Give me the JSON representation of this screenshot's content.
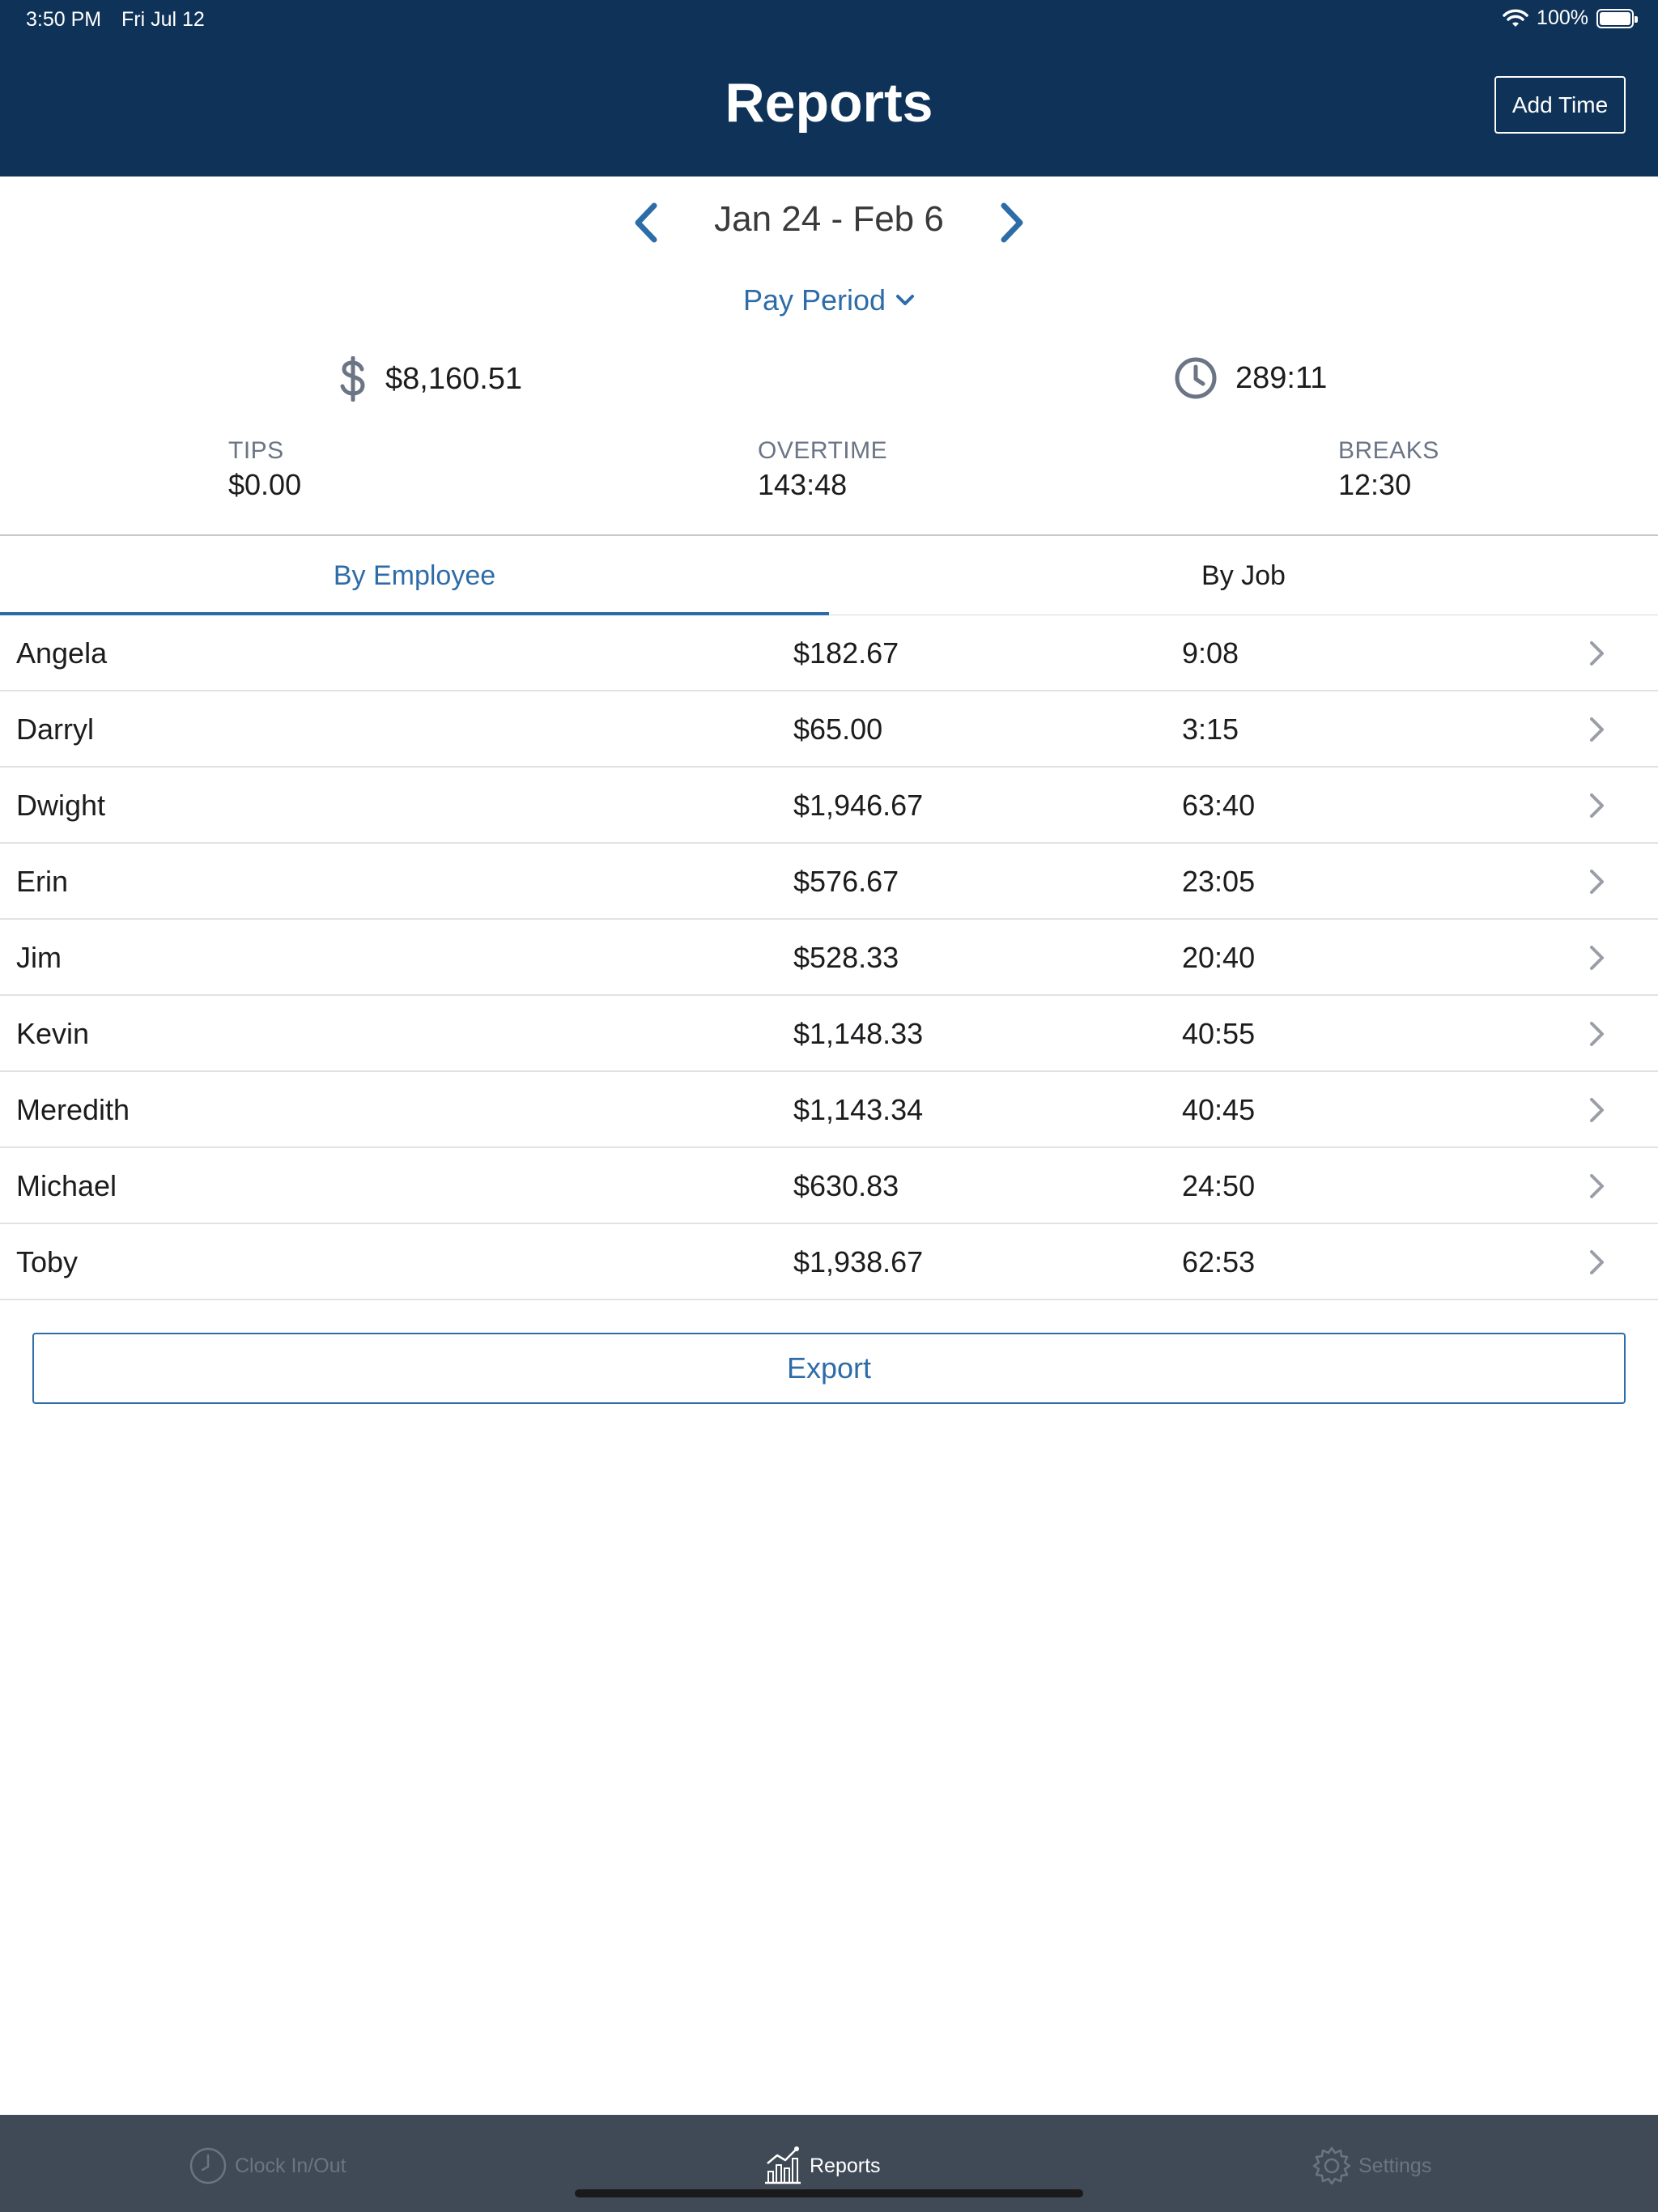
{
  "status_bar": {
    "time": "3:50 PM",
    "date": "Fri Jul 12",
    "battery": "100%"
  },
  "header": {
    "title": "Reports",
    "add_time_label": "Add Time"
  },
  "date_nav": {
    "range": "Jan 24 - Feb 6",
    "period": "Pay Period"
  },
  "totals": {
    "pay": "$8,160.51",
    "hours": "289:11"
  },
  "stats": {
    "tips": {
      "label": "TIPS",
      "value": "$0.00"
    },
    "overtime": {
      "label": "OVERTIME",
      "value": "143:48"
    },
    "breaks": {
      "label": "BREAKS",
      "value": "12:30"
    }
  },
  "tabs": {
    "employee": "By Employee",
    "job": "By Job",
    "active": "employee"
  },
  "rows": [
    {
      "name": "Angela",
      "pay": "$182.67",
      "hours": "9:08"
    },
    {
      "name": "Darryl",
      "pay": "$65.00",
      "hours": "3:15"
    },
    {
      "name": "Dwight",
      "pay": "$1,946.67",
      "hours": "63:40"
    },
    {
      "name": "Erin",
      "pay": "$576.67",
      "hours": "23:05"
    },
    {
      "name": "Jim",
      "pay": "$528.33",
      "hours": "20:40"
    },
    {
      "name": "Kevin",
      "pay": "$1,148.33",
      "hours": "40:55"
    },
    {
      "name": "Meredith",
      "pay": "$1,143.34",
      "hours": "40:45"
    },
    {
      "name": "Michael",
      "pay": "$630.83",
      "hours": "24:50"
    },
    {
      "name": "Toby",
      "pay": "$1,938.67",
      "hours": "62:53"
    }
  ],
  "export_label": "Export",
  "tabbar": {
    "clock": {
      "label": "Clock In/Out",
      "icon": "clock-icon"
    },
    "reports": {
      "label": "Reports",
      "icon": "chart-icon"
    },
    "settings": {
      "label": "Settings",
      "icon": "gear-icon"
    }
  },
  "colors": {
    "header": "#0f3358",
    "accent": "#2e6ca8",
    "tabbar": "#404a56"
  }
}
